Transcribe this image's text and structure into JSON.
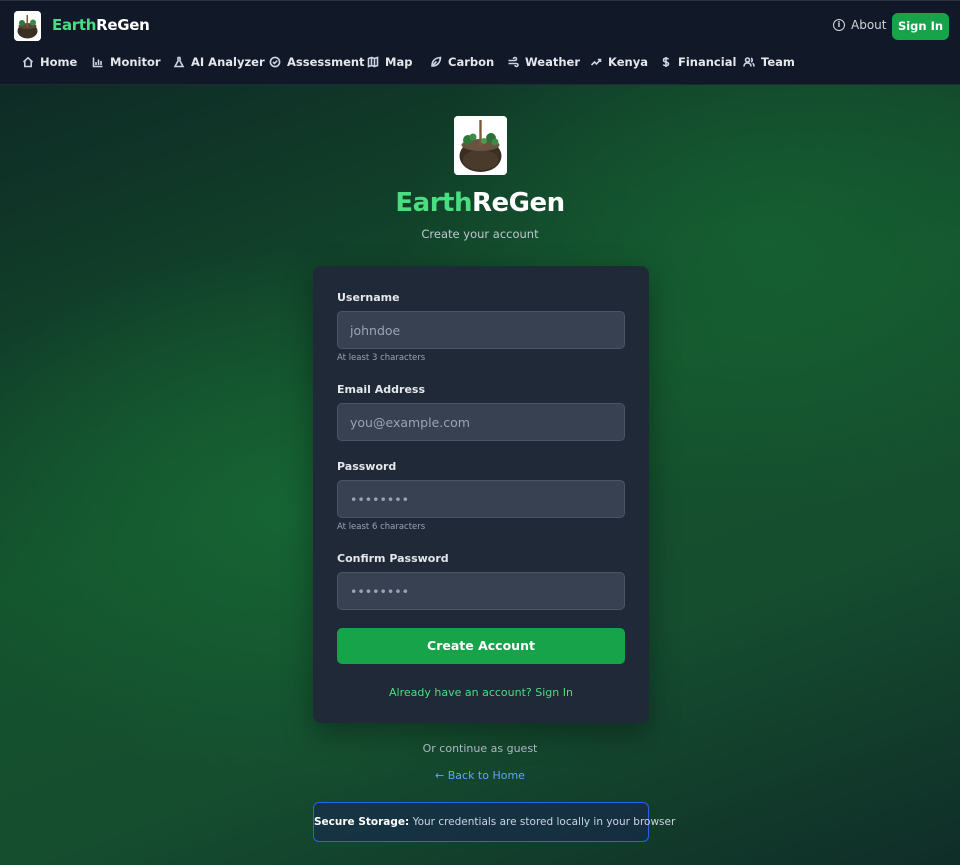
{
  "app": {
    "brand_earth": "Earth",
    "brand_regen": "ReGen"
  },
  "header": {
    "about_label": "About",
    "signin_label": "Sign In",
    "nav": [
      {
        "label": "Home",
        "icon": "home-icon"
      },
      {
        "label": "Monitor",
        "icon": "bar-chart-icon"
      },
      {
        "label": "AI Analyzer",
        "icon": "flask-icon"
      },
      {
        "label": "Assessment",
        "icon": "check-circle-icon"
      },
      {
        "label": "Map",
        "icon": "map-icon"
      },
      {
        "label": "Carbon",
        "icon": "leaf-icon"
      },
      {
        "label": "Weather",
        "icon": "wind-icon"
      },
      {
        "label": "Kenya",
        "icon": "trending-up-icon"
      },
      {
        "label": "Financial",
        "icon": "dollar-icon"
      },
      {
        "label": "Team",
        "icon": "users-icon"
      }
    ]
  },
  "hero": {
    "title_earth": "Earth",
    "title_regen": "ReGen",
    "subtitle": "Create your account"
  },
  "form": {
    "username": {
      "label": "Username",
      "placeholder": "johndoe",
      "hint": "At least 3 characters"
    },
    "email": {
      "label": "Email Address",
      "placeholder": "you@example.com"
    },
    "password": {
      "label": "Password",
      "placeholder": "••••••••",
      "hint": "At least 6 characters"
    },
    "confirm": {
      "label": "Confirm Password",
      "placeholder": "••••••••"
    },
    "submit_label": "Create Account",
    "signin_link": "Already have an account? Sign In"
  },
  "footer": {
    "guest_text": "Or continue as guest",
    "back_home": "← Back to Home",
    "secure_title": "Secure Storage:",
    "secure_text": " Your credentials are stored locally in your browser"
  },
  "colors": {
    "accent_green": "#16a34a",
    "brand_green": "#4ade80",
    "link_blue": "#60a5fa",
    "card_bg": "#1f2937",
    "header_bg": "#111827"
  }
}
